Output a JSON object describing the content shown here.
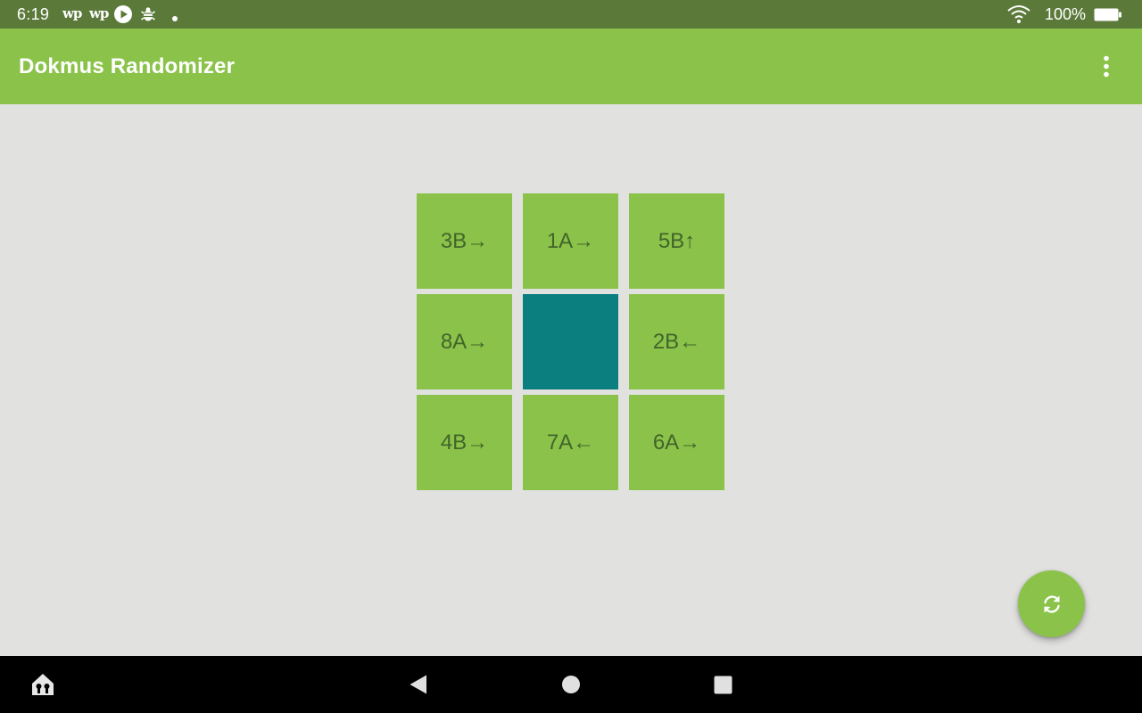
{
  "status_bar": {
    "time": "6:19",
    "notification_icons": [
      "wp",
      "wp",
      "play-icon",
      "bug-icon",
      "dot-icon"
    ],
    "wp_label": "wp",
    "battery_text": "100%",
    "background_color": "#5b7a3a"
  },
  "app_bar": {
    "title": "Dokmus Randomizer",
    "overflow_icon": "more-vert-icon",
    "background_color": "#8bc34a"
  },
  "grid": {
    "tiles": [
      {
        "label": "3B→"
      },
      {
        "label": "1A→"
      },
      {
        "label": "5B↑"
      },
      {
        "label": "8A→"
      },
      {
        "label": ""
      },
      {
        "label": "2B←"
      },
      {
        "label": "4B→"
      },
      {
        "label": "7A←"
      },
      {
        "label": "6A→"
      }
    ],
    "tile_color": "#8bc34a",
    "empty_tile_color": "#0b7f7f",
    "label_color": "#42642a"
  },
  "fab": {
    "icon": "refresh-icon"
  },
  "nav_bar": {
    "items": [
      "home-icon",
      "back-icon",
      "home-circle-icon",
      "recents-icon"
    ]
  }
}
